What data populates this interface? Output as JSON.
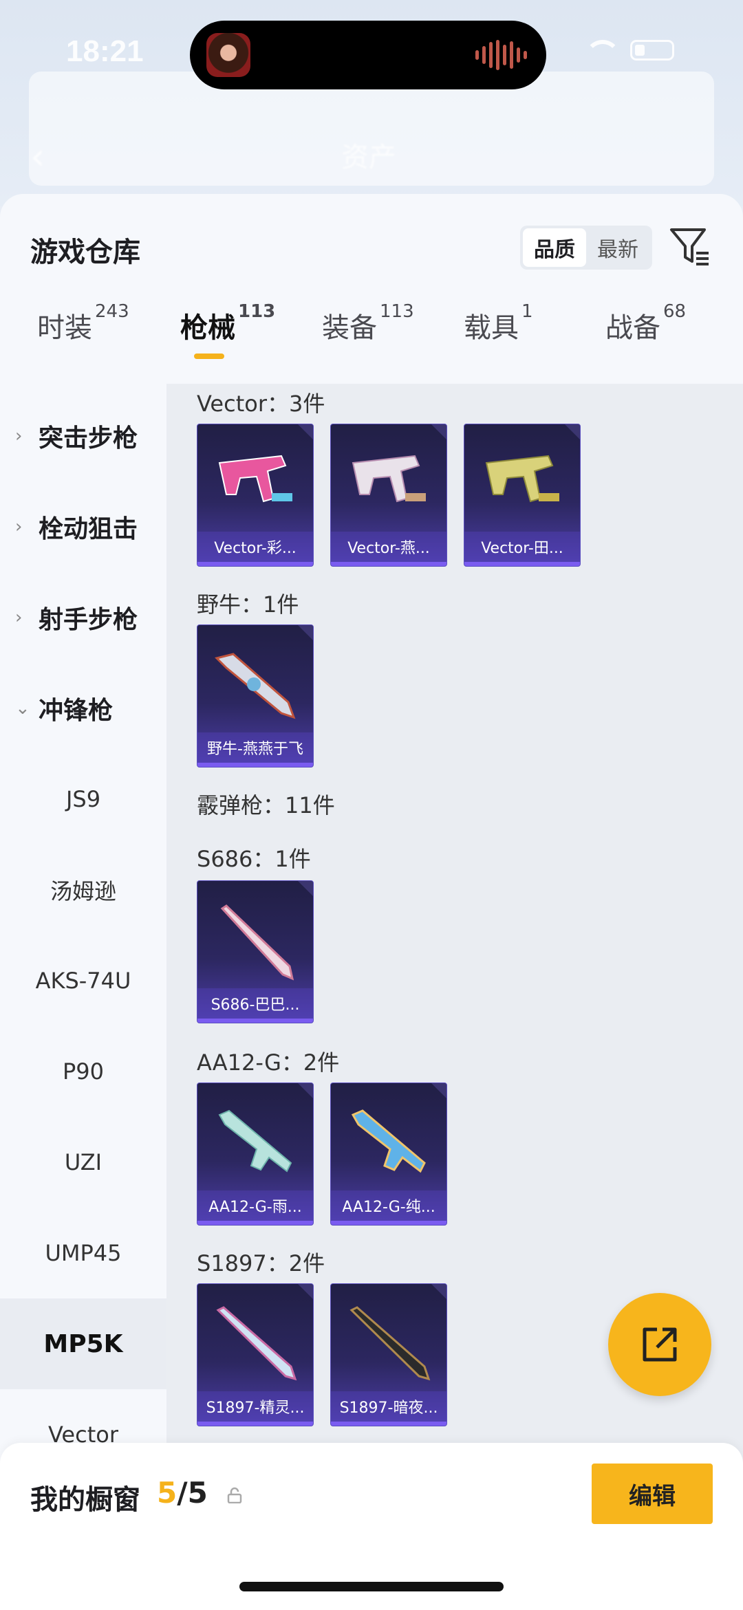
{
  "status": {
    "time": "18:21"
  },
  "header_bg": {
    "title": "资产"
  },
  "sheet": {
    "title": "游戏仓库"
  },
  "sort": {
    "options": [
      "品质",
      "最新"
    ],
    "active": 0
  },
  "tabs": [
    {
      "label": "时装",
      "count": "243"
    },
    {
      "label": "枪械",
      "count": "113"
    },
    {
      "label": "装备",
      "count": "113"
    },
    {
      "label": "载具",
      "count": "1"
    },
    {
      "label": "战备",
      "count": "68"
    }
  ],
  "active_tab": 1,
  "subnav": [
    {
      "label": "突击步枪",
      "type": "group"
    },
    {
      "label": "栓动狙击",
      "type": "group"
    },
    {
      "label": "射手步枪",
      "type": "group"
    },
    {
      "label": "冲锋枪",
      "type": "group",
      "expanded": true
    },
    {
      "label": "JS9",
      "type": "item"
    },
    {
      "label": "汤姆逊",
      "type": "item"
    },
    {
      "label": "AKS-74U",
      "type": "item"
    },
    {
      "label": "P90",
      "type": "item"
    },
    {
      "label": "UZI",
      "type": "item"
    },
    {
      "label": "UMP45",
      "type": "item"
    },
    {
      "label": "MP5K",
      "type": "item",
      "selected": true
    },
    {
      "label": "Vector",
      "type": "item"
    }
  ],
  "sections": [
    {
      "title": "Vector：3件",
      "items": [
        "Vector-彩...",
        "Vector-燕...",
        "Vector-田..."
      ]
    },
    {
      "title": "野牛：1件",
      "items": [
        "野牛-燕燕于飞"
      ]
    },
    {
      "title": "霰弹枪：11件",
      "items": []
    },
    {
      "title": "S686：1件",
      "items": [
        "S686-巴巴..."
      ]
    },
    {
      "title": "AA12-G：2件",
      "items": [
        "AA12-G-雨...",
        "AA12-G-纯..."
      ]
    },
    {
      "title": "S1897：2件",
      "items": [
        "S1897-精灵...",
        "S1897-暗夜..."
      ]
    }
  ],
  "bottom": {
    "label": "我的橱窗",
    "count": "5",
    "total": "/5",
    "edit": "编辑"
  },
  "colors": {
    "accent": "#f7b51c",
    "card_top": "#211f45",
    "card_bottom": "#4d3ea8"
  }
}
